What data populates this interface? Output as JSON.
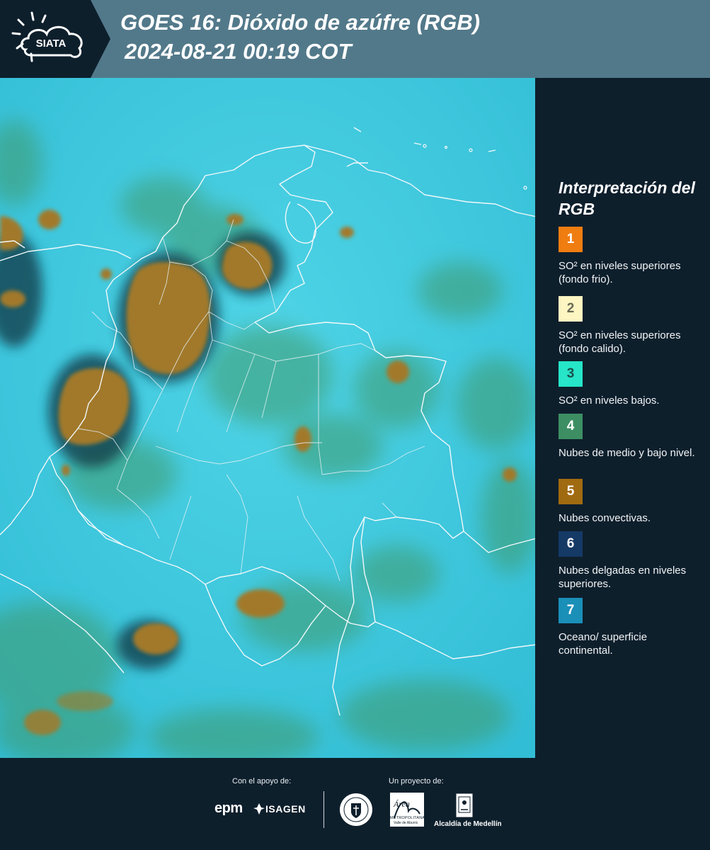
{
  "header": {
    "logo_text": "SIATA",
    "title_line1": "GOES 16: Dióxido de azúfre (RGB)",
    "title_line2": "2024-08-21 00:19 COT"
  },
  "legend": {
    "title": "Interpretación del RGB",
    "items": [
      {
        "number": "1",
        "color": "#f07d10",
        "text": "SO² en niveles superiores (fondo frio)."
      },
      {
        "number": "2",
        "color": "#fdf6c3",
        "text": "SO² en niveles superiores (fondo calido)."
      },
      {
        "number": "3",
        "color": "#26e5c8",
        "text": "SO² en niveles bajos."
      },
      {
        "number": "4",
        "color": "#3d8f63",
        "text": "Nubes de medio y bajo nivel."
      },
      {
        "number": "5",
        "color": "#a06a10",
        "text": "Nubes convectivas."
      },
      {
        "number": "6",
        "color": "#153a66",
        "text": "Nubes delgadas en niveles superiores."
      },
      {
        "number": "7",
        "color": "#1a8fb8",
        "text": "Oceano/ superficie continental."
      }
    ]
  },
  "footer": {
    "support_label": "Con el apoyo de:",
    "project_label": "Un proyecto de:",
    "logos": {
      "epm": "epm",
      "isagen": "ISAGEN",
      "area_metro": "Área",
      "area_metro_sub": "METROPOLITANA",
      "area_metro_sub2": "Valle de Aburrá",
      "alcaldia": "Alcaldía de Medellín"
    }
  },
  "colors": {
    "background": "#0e1f2c",
    "header": "#52798a",
    "map_base": "#3ec8dd",
    "convective": "#a07a2c"
  }
}
